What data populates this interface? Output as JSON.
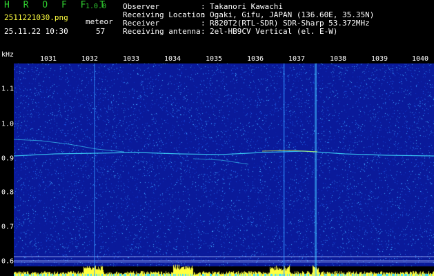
{
  "header": {
    "app_title": "H R O F F T",
    "app_version": "1.0.0",
    "file_name": "2511221030.png",
    "detect_label": "meteor",
    "timestamp": "25.11.22 10:30",
    "detect_count": "57",
    "meta": [
      {
        "key": "Observer",
        "sep": ":",
        "value": "Takanori Kawachi"
      },
      {
        "key": "Receiving Location",
        "sep": ":",
        "value": "Ogaki, Gifu, JAPAN (136.60E, 35.35N)"
      },
      {
        "key": "Receiver",
        "sep": ":",
        "value": "R820T2(RTL-SDR) SDR-Sharp 53.372MHz"
      },
      {
        "key": "Receiving antenna",
        "sep": ":",
        "value": "2el-HB9CV Vertical (el. E-W)"
      }
    ]
  },
  "axes": {
    "freq_unit": "kHz",
    "x_ticks": [
      "1031",
      "1032",
      "1033",
      "1034",
      "1035",
      "1036",
      "1037",
      "1038",
      "1039",
      "1040"
    ],
    "y_ticks": [
      "1.1",
      "1.0",
      "0.9",
      "0.8",
      "0.7",
      "0.6"
    ]
  },
  "colors": {
    "background": "#000000",
    "header_green": "#30d030",
    "header_text": "#ffffff",
    "waterfall_base": "#0a1a9a",
    "signal_cyan": "#40e0ff",
    "level_yellow": "#ffff40"
  }
}
